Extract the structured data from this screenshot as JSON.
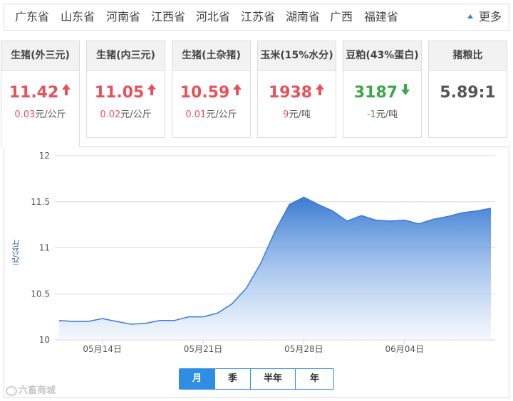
{
  "regions": [
    "广东省",
    "山东省",
    "河南省",
    "江西省",
    "河北省",
    "江苏省",
    "湖南省",
    "广西",
    "福建省"
  ],
  "more_label": "更多",
  "cards": [
    {
      "name": "生猪(外三元)",
      "price": "11.42",
      "change": "0.03",
      "unit": "元/公斤",
      "direction": "up"
    },
    {
      "name": "生猪(内三元)",
      "price": "11.05",
      "change": "0.02",
      "unit": "元/公斤",
      "direction": "up"
    },
    {
      "name": "生猪(土杂猪)",
      "price": "10.59",
      "change": "0.01",
      "unit": "元/公斤",
      "direction": "up"
    },
    {
      "name": "玉米(15%水分)",
      "price": "1938",
      "change": "9",
      "unit": "元/吨",
      "direction": "up"
    },
    {
      "name": "豆粕(43%蛋白)",
      "price": "3187",
      "change": "-1",
      "unit": "元/吨",
      "direction": "down"
    },
    {
      "name": "猪粮比",
      "price": "5.89:1",
      "change": "",
      "unit": "",
      "direction": "none"
    }
  ],
  "colors": {
    "up": "#e8505b",
    "down": "#3aa74a",
    "accent": "#2f8de4",
    "line": "#3a7bd5"
  },
  "tabs": [
    "月",
    "季",
    "半年",
    "年"
  ],
  "active_tab": "月",
  "watermark": "六畜商城",
  "chart_data": {
    "type": "area",
    "title": "",
    "xlabel": "",
    "ylabel": "元/公斤",
    "ylim": [
      10,
      12
    ],
    "yticks": [
      "10",
      "10.5",
      "11",
      "11.5",
      "12"
    ],
    "xticks": [
      "05月14日",
      "05月21日",
      "05月28日",
      "06月04日"
    ],
    "x": [
      "05-11",
      "05-12",
      "05-13",
      "05-14",
      "05-15",
      "05-16",
      "05-17",
      "05-18",
      "05-19",
      "05-20",
      "05-21",
      "05-22",
      "05-23",
      "05-24",
      "05-25",
      "05-26",
      "05-27",
      "05-28",
      "05-29",
      "05-30",
      "05-31",
      "06-01",
      "06-02",
      "06-03",
      "06-04",
      "06-05",
      "06-06",
      "06-07",
      "06-08",
      "06-09",
      "06-10"
    ],
    "series": [
      {
        "values": [
          10.21,
          10.2,
          10.2,
          10.23,
          10.2,
          10.17,
          10.18,
          10.21,
          10.21,
          10.25,
          10.25,
          10.29,
          10.39,
          10.56,
          10.83,
          11.18,
          11.47,
          11.55,
          11.47,
          11.4,
          11.29,
          11.35,
          11.3,
          11.29,
          11.3,
          11.26,
          11.31,
          11.34,
          11.38,
          11.4,
          11.43
        ]
      }
    ],
    "grid": true,
    "legend": "none"
  }
}
